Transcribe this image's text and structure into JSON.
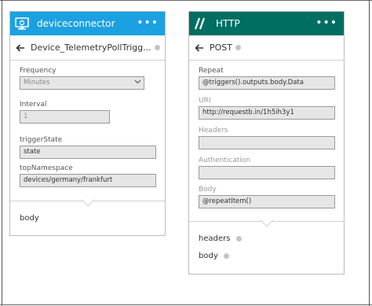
{
  "left_card": {
    "connector_title": "deviceconnector",
    "more_label": "•••",
    "action_title": "Device_TelemetryPollTrigg...",
    "fields": {
      "frequency": {
        "label": "Frequency",
        "value": "Minutes"
      },
      "interval": {
        "label": "Interval",
        "value": "1"
      },
      "trigger_state": {
        "label": "triggerState",
        "value": "state"
      },
      "top_namespace": {
        "label": "topNamespace",
        "value": "devices/germany/frankfurt"
      }
    },
    "outputs": [
      "body"
    ]
  },
  "right_card": {
    "connector_title": "HTTP",
    "more_label": "•••",
    "action_title": "POST",
    "fields": {
      "repeat": {
        "label": "Repeat",
        "value": "@triggers().outputs.body.Data"
      },
      "uri": {
        "label": "URI",
        "value": "http://requestb.in/1h5ih3y1"
      },
      "headers": {
        "label": "Headers",
        "value": ""
      },
      "authentication": {
        "label": "Authentication",
        "value": ""
      },
      "body": {
        "label": "Body",
        "value": "@repeatItem()"
      }
    },
    "outputs": [
      "headers",
      "body"
    ]
  },
  "colors": {
    "device_header": "#1ba1e2",
    "http_header": "#006e62"
  },
  "icons": [
    "device-connector-icon",
    "http-icon",
    "back-arrow-icon",
    "info-icon",
    "more-icon",
    "chevron-down-icon"
  ]
}
